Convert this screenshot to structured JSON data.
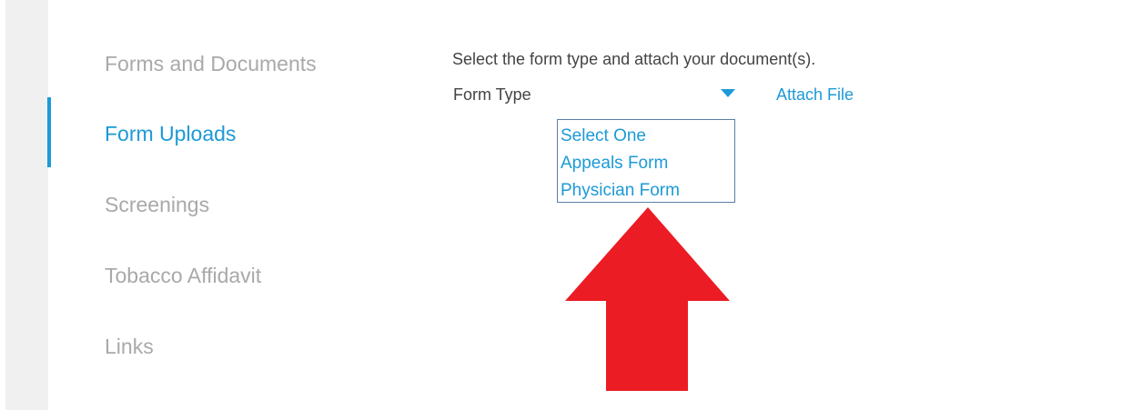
{
  "sidebar": {
    "items": [
      {
        "label": "Forms and Documents"
      },
      {
        "label": "Form Uploads"
      },
      {
        "label": "Screenings"
      },
      {
        "label": "Tobacco Affidavit"
      },
      {
        "label": "Links"
      }
    ],
    "active_index": 1
  },
  "main": {
    "instructions": "Select the form type and attach your document(s).",
    "form_type_label": "Form Type",
    "attach_file_label": "Attach File",
    "dropdown": {
      "options": [
        "Select One",
        "Appeals Form",
        "Physician Form"
      ]
    }
  },
  "annotation": {
    "arrow_color": "#ec1c24",
    "arrow_icon": "red-up-arrow"
  },
  "colors": {
    "accent": "#1c9ad6",
    "inactive_text": "#a9a9a9",
    "body_text": "#444444"
  }
}
